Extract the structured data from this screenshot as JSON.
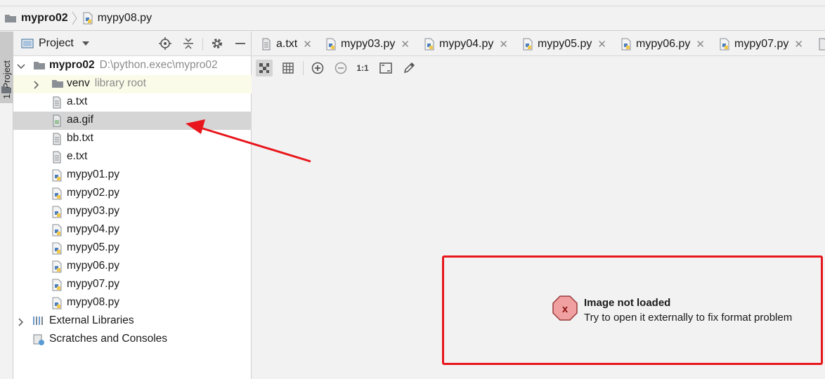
{
  "breadcrumb": {
    "project": "mypro02",
    "file": "mypy08.py"
  },
  "toolwindow_tab": {
    "label": "1: Project"
  },
  "project_panel": {
    "title": "Project",
    "tree": [
      {
        "label": "mypro02",
        "hint": "D:\\python.exec\\mypro02",
        "type": "folder-open",
        "level": 0,
        "bold": true
      },
      {
        "label": "venv",
        "hint": "library root",
        "type": "folder-closed",
        "level": 1
      },
      {
        "label": "a.txt",
        "type": "text",
        "level": 1
      },
      {
        "label": "aa.gif",
        "type": "image",
        "level": 1,
        "selected": true
      },
      {
        "label": "bb.txt",
        "type": "text",
        "level": 1
      },
      {
        "label": "e.txt",
        "type": "text",
        "level": 1
      },
      {
        "label": "mypy01.py",
        "type": "python",
        "level": 1
      },
      {
        "label": "mypy02.py",
        "type": "python",
        "level": 1
      },
      {
        "label": "mypy03.py",
        "type": "python",
        "level": 1
      },
      {
        "label": "mypy04.py",
        "type": "python",
        "level": 1
      },
      {
        "label": "mypy05.py",
        "type": "python",
        "level": 1
      },
      {
        "label": "mypy06.py",
        "type": "python",
        "level": 1
      },
      {
        "label": "mypy07.py",
        "type": "python",
        "level": 1
      },
      {
        "label": "mypy08.py",
        "type": "python",
        "level": 1
      },
      {
        "label": "External Libraries",
        "type": "libraries",
        "level": 0
      },
      {
        "label": "Scratches and Consoles",
        "type": "scratches",
        "level": 0
      }
    ]
  },
  "editor_tabs": [
    {
      "label": "a.txt",
      "icon": "text-file-icon"
    },
    {
      "label": "mypy03.py",
      "icon": "python-file-icon"
    },
    {
      "label": "mypy04.py",
      "icon": "python-file-icon"
    },
    {
      "label": "mypy05.py",
      "icon": "python-file-icon"
    },
    {
      "label": "mypy06.py",
      "icon": "python-file-icon"
    },
    {
      "label": "mypy07.py",
      "icon": "python-file-icon"
    }
  ],
  "image_toolbar": {
    "items": [
      "chessboard-icon",
      "grid-icon",
      "zoom-in-icon",
      "zoom-out-icon",
      "actual-size-icon",
      "fit-window-icon",
      "color-picker-icon"
    ],
    "actual_size_label": "1:1"
  },
  "error": {
    "title": "Image not loaded",
    "message": "Try to open it externally to fix format problem"
  },
  "colors": {
    "annotation": "#e8161c",
    "selection": "#d5d5d5",
    "library_row": "#fbfbe9"
  }
}
